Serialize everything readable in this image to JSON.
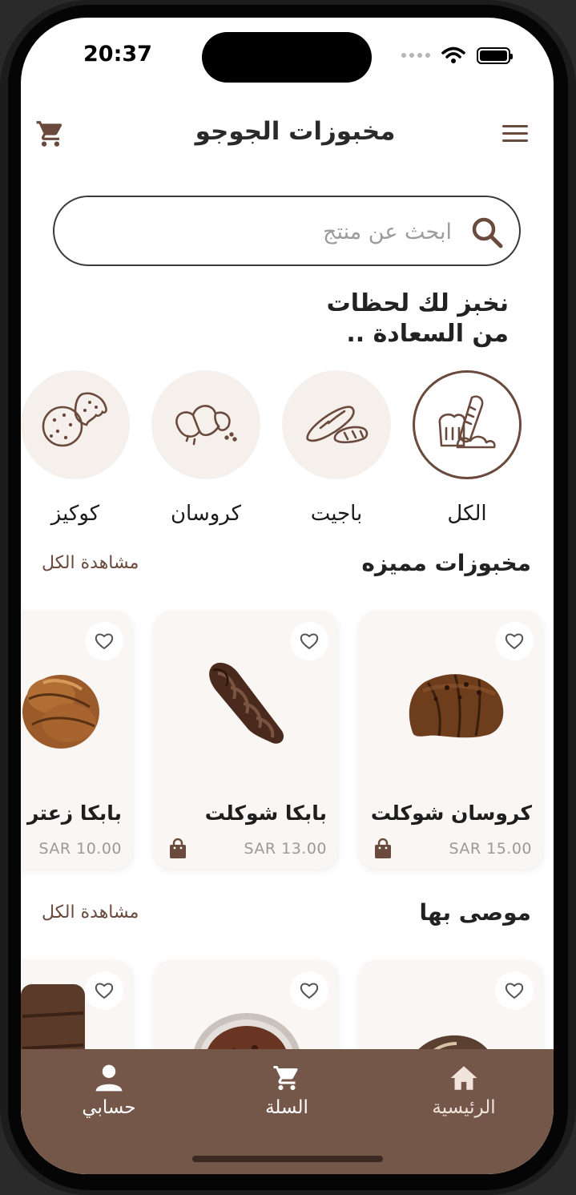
{
  "status_bar": {
    "time": "20:37"
  },
  "header": {
    "title": "مخبوزات الجوجو"
  },
  "search": {
    "placeholder": "ابحث عن منتج"
  },
  "tagline": {
    "line1": "نخبز لك لحظات",
    "line2": "من السعادة .."
  },
  "categories": [
    {
      "label": "الكل",
      "icon": "bread-basket-icon",
      "active": true
    },
    {
      "label": "باجيت",
      "icon": "baguette-icon",
      "active": false
    },
    {
      "label": "كروسان",
      "icon": "croissant-icon",
      "active": false
    },
    {
      "label": "كوكيز",
      "icon": "cookies-icon",
      "active": false
    }
  ],
  "featured": {
    "title": "مخبوزات مميزه",
    "see_all": "مشاهدة الكل",
    "items": [
      {
        "name": "كروسان شوكلت",
        "price": "SAR 15.00"
      },
      {
        "name": "بابكا شوكلت",
        "price": "SAR 13.00"
      },
      {
        "name": "بابكا زعتر",
        "price": "SAR 10.00"
      }
    ]
  },
  "recommended": {
    "title": "موصى بها",
    "see_all": "مشاهدة الكل"
  },
  "bottom_nav": [
    {
      "label": "الرئيسية",
      "icon": "home-icon",
      "active": true
    },
    {
      "label": "السلة",
      "icon": "cart-icon",
      "active": false
    },
    {
      "label": "حسابي",
      "icon": "person-icon",
      "active": false
    }
  ],
  "colors": {
    "accent": "#6b4a3e",
    "nav_bg": "#75574a",
    "card_bg": "#f9f6f4"
  }
}
